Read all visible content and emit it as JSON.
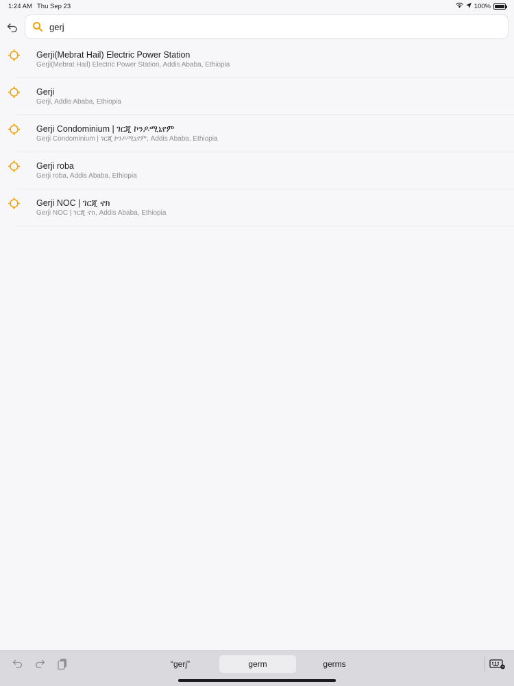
{
  "status_bar": {
    "time": "1:24 AM",
    "date": "Thu Sep 23",
    "battery": "100%"
  },
  "search": {
    "value": "gerj",
    "placeholder": ""
  },
  "results": [
    {
      "title": "Gerji(Mebrat Hail) Electric Power Station",
      "subtitle": "Gerji(Mebrat Hail) Electric Power Station, Addis Ababa, Ethiopia"
    },
    {
      "title": "Gerji",
      "subtitle": "Gerji, Addis Ababa, Ethiopia"
    },
    {
      "title": "Gerji Condominium | ገርጂ ኮንዶሚኒየም",
      "subtitle": "Gerji Condominium | ገርጂ ኮንዶሚኒየም, Addis Ababa, Ethiopia"
    },
    {
      "title": "Gerji roba",
      "subtitle": "Gerji roba, Addis Ababa, Ethiopia"
    },
    {
      "title": "Gerji NOC | ገርጂ ኖክ",
      "subtitle": "Gerji NOC | ገርጂ ኖክ, Addis Ababa, Ethiopia"
    }
  ],
  "keyboard": {
    "suggestions": [
      "“gerj”",
      "germ",
      "germs"
    ]
  },
  "colors": {
    "accent": "#f0a30a",
    "background": "#f7f7f9"
  },
  "icons": {
    "back": "back-arrow-icon",
    "search": "search-icon",
    "result": "location-target-icon"
  }
}
